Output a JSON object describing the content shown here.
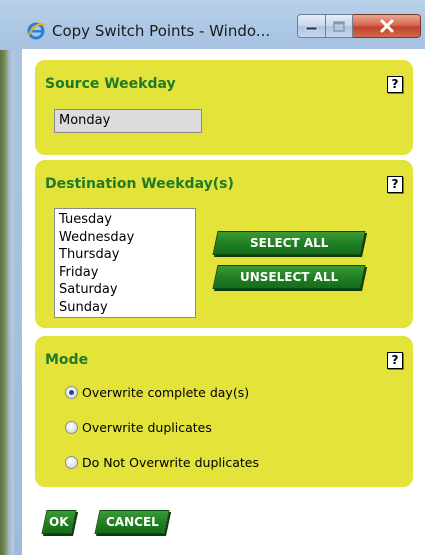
{
  "window": {
    "title": "Copy Switch Points - Windo...",
    "controls": {
      "minimize": "minimize",
      "maximize": "maximize",
      "close": "X"
    }
  },
  "source": {
    "title": "Source Weekday",
    "help": "?",
    "value": "Monday"
  },
  "destination": {
    "title": "Destination Weekday(s)",
    "help": "?",
    "days": [
      "Tuesday",
      "Wednesday",
      "Thursday",
      "Friday",
      "Saturday",
      "Sunday"
    ],
    "select_all": "SELECT ALL",
    "unselect_all": "UNSELECT ALL"
  },
  "mode": {
    "title": "Mode",
    "help": "?",
    "options": [
      {
        "label": "Overwrite complete day(s)",
        "checked": true
      },
      {
        "label": "Overwrite duplicates",
        "checked": false
      },
      {
        "label": "Do Not Overwrite duplicates",
        "checked": false
      }
    ]
  },
  "footer": {
    "ok": "OK",
    "cancel": "CANCEL"
  },
  "colors": {
    "panel": "#e3e33a",
    "panel_title": "#1f7a2b",
    "button_green": "#1f7e22"
  },
  "icons": {
    "app": "internet-explorer-icon",
    "minimize": "minimize-icon",
    "maximize": "maximize-icon",
    "close": "close-icon",
    "help": "help-icon"
  }
}
